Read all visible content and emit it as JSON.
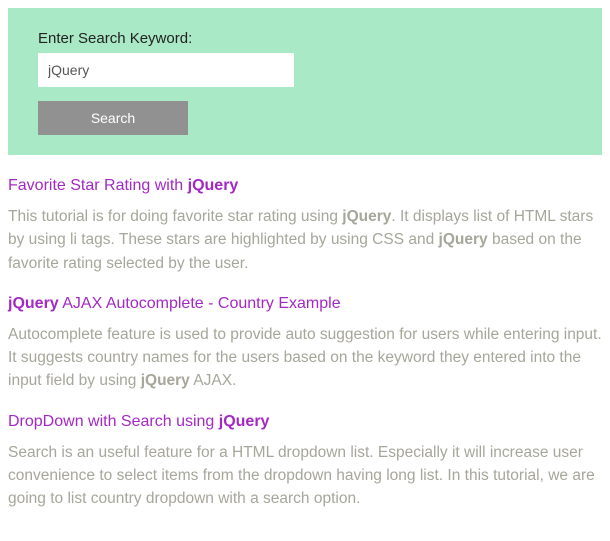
{
  "search": {
    "label": "Enter Search Keyword:",
    "value": "jQuery",
    "button": "Search"
  },
  "results": [
    {
      "title_pre": "Favorite Star Rating with ",
      "title_hl": "jQuery",
      "title_post": "",
      "desc_html": "This tutorial is for doing favorite star rating using <b>jQuery</b>. It displays list of HTML stars by using li tags. These stars are highlighted by using CSS and <b>jQuery</b> based on the favorite rating selected by the user."
    },
    {
      "title_pre": "",
      "title_hl": "jQuery",
      "title_post": " AJAX Autocomplete - Country Example",
      "desc_html": "Autocomplete feature is used to provide auto suggestion for users while entering input. It suggests country names for the users based on the keyword they entered into the input field by using <b>jQuery</b> AJAX."
    },
    {
      "title_pre": "DropDown with Search using ",
      "title_hl": "jQuery",
      "title_post": "",
      "desc_html": "Search is an useful feature for a HTML dropdown list. Especially it will increase user convenience to select items from the dropdown having long list. In this tutorial, we are going to list country dropdown with a search option."
    }
  ]
}
